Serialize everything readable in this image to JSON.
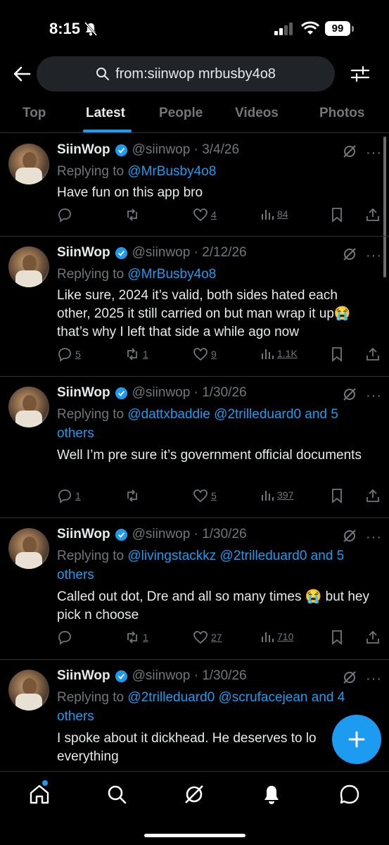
{
  "status": {
    "time": "8:15",
    "battery": "99"
  },
  "search": {
    "query": "from:siinwop mrbusby4o8"
  },
  "tabs": [
    {
      "label": "Top"
    },
    {
      "label": "Latest"
    },
    {
      "label": "People"
    },
    {
      "label": "Videos"
    },
    {
      "label": "Photos"
    }
  ],
  "tweets": [
    {
      "name": "SiinWop",
      "handle": "@siinwop",
      "date": "3/4/26",
      "replying_prefix": "Replying to",
      "mentions": "@MrBusby4o8",
      "mentions_suffix": "",
      "text": "Have fun on this app bro",
      "replies": "",
      "reposts": "",
      "likes": "4",
      "views": "84"
    },
    {
      "name": "SiinWop",
      "handle": "@siinwop",
      "date": "2/12/26",
      "replying_prefix": "Replying to",
      "mentions": "@MrBusby4o8",
      "mentions_suffix": "",
      "text": "Like sure, 2024 it’s valid, both sides hated each other, 2025 it still carried on but man wrap it up😭 that’s why I left that side a while ago now",
      "replies": "5",
      "reposts": "1",
      "likes": "9",
      "views": "1.1K"
    },
    {
      "name": "SiinWop",
      "handle": "@siinwop",
      "date": "1/30/26",
      "replying_prefix": "Replying to",
      "mentions": "@dattxbaddie @2trilleduard0 and 5 others",
      "mentions_suffix": "",
      "text": "Well I’m pre sure it’s government official documents",
      "replies": "1",
      "reposts": "",
      "likes": "5",
      "views": "397"
    },
    {
      "name": "SiinWop",
      "handle": "@siinwop",
      "date": "1/30/26",
      "replying_prefix": "Replying to",
      "mentions": "@livingstackkz @2trilleduard0 and 5 others",
      "mentions_suffix": "",
      "text": "Called out dot, Dre and all so many times 😭 but hey pick n choose",
      "replies": "",
      "reposts": "1",
      "likes": "27",
      "views": "710"
    },
    {
      "name": "SiinWop",
      "handle": "@siinwop",
      "date": "1/30/26",
      "replying_prefix": "Replying to",
      "mentions": "@2trilleduard0 @scrufacejean and 4 others",
      "mentions_suffix": "",
      "text": "I spoke about it dickhead. He deserves to lo everything",
      "replies": "",
      "reposts": "",
      "likes": "",
      "views": ""
    }
  ],
  "colors": {
    "accent": "#1d9bf0",
    "muted": "#71767b",
    "background": "#000000"
  },
  "icons": [
    "back-arrow-icon",
    "search-icon",
    "filter-icon",
    "verified-icon",
    "grok-icon",
    "more-icon",
    "reply-icon",
    "repost-icon",
    "like-icon",
    "views-icon",
    "bookmark-icon",
    "share-icon",
    "home-icon",
    "explore-icon",
    "notifications-icon",
    "messages-icon",
    "compose-icon"
  ]
}
